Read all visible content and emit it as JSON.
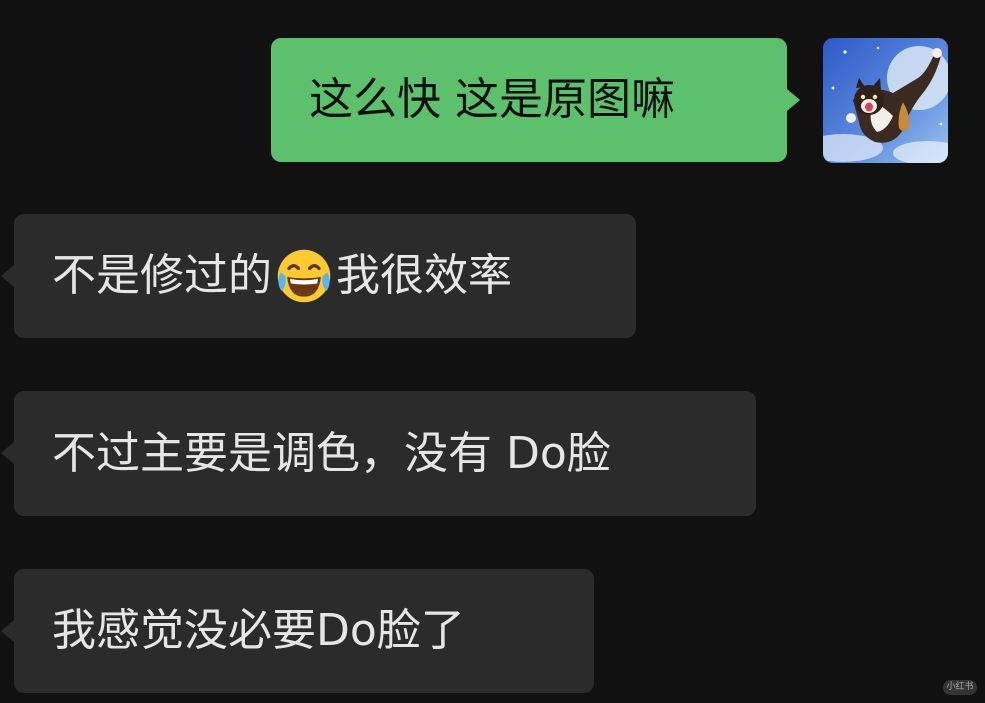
{
  "messages": [
    {
      "sender": "me",
      "text": "这么快 这是原图嘛"
    },
    {
      "sender": "other",
      "text_before": "不是修过的",
      "emoji": "face-with-tears-of-joy",
      "text_after": "我很效率"
    },
    {
      "sender": "other",
      "text": "不过主要是调色，没有 Do脸"
    },
    {
      "sender": "other",
      "text": "我感觉没必要Do脸了"
    }
  ],
  "avatar": {
    "icon": "flying-cat-avatar-icon",
    "bg_color": "#4a6fc8"
  },
  "watermark": {
    "text": "小红书"
  },
  "colors": {
    "background": "#111111",
    "my_bubble": "#5cc06c",
    "other_bubble": "#2b2b2b",
    "other_text": "#e6e6e6"
  }
}
